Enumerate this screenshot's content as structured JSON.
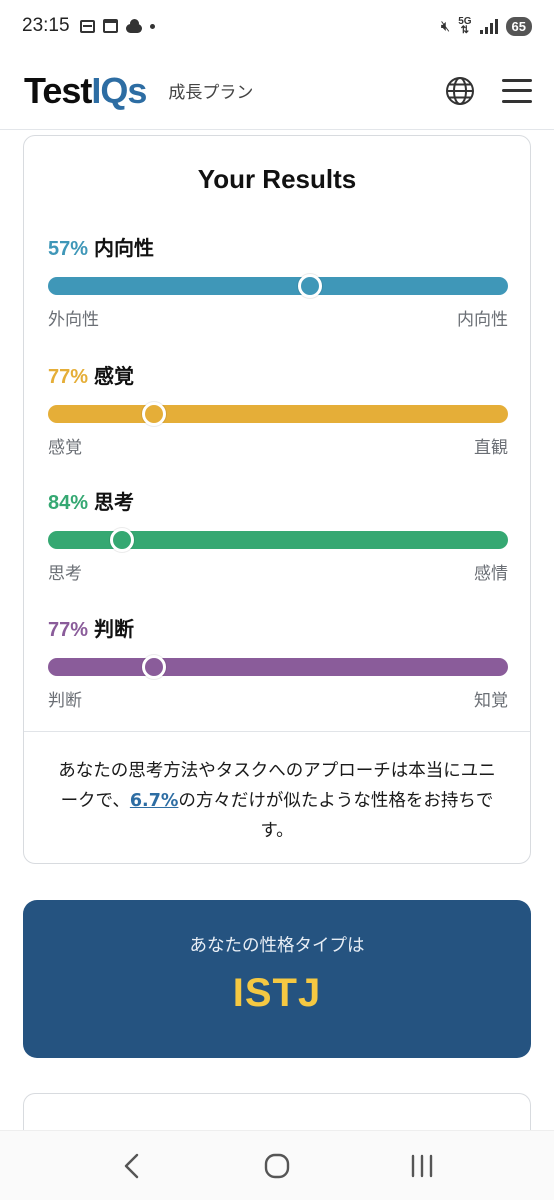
{
  "status_bar": {
    "time": "23:15",
    "network": "5G",
    "battery": "65"
  },
  "header": {
    "logo_part1": "Test",
    "logo_part2": "IQs",
    "plan_label": "成長プラン",
    "icons": [
      "globe-icon",
      "hamburger-menu-icon"
    ]
  },
  "results": {
    "title": "Your Results",
    "traits": [
      {
        "percent": "57%",
        "name": "内向性",
        "left": "外向性",
        "right": "内向性",
        "color": "#3f97b8",
        "level": 0.57
      },
      {
        "percent": "77%",
        "name": "感覚",
        "left": "感覚",
        "right": "直観",
        "color": "#e5ae38",
        "level": 0.23
      },
      {
        "percent": "84%",
        "name": "思考",
        "left": "思考",
        "right": "感情",
        "color": "#35a872",
        "level": 0.16
      },
      {
        "percent": "77%",
        "name": "判断",
        "left": "判断",
        "right": "知覚",
        "color": "#8a5c9a",
        "level": 0.23
      }
    ],
    "summary_before": "あなたの思考方法やタスクへのアプローチは本当にユニークで、",
    "summary_link": "6.7%",
    "summary_after": "の方々だけが似たような性格をお持ちです。"
  },
  "type_box": {
    "label": "あなたの性格タイプは",
    "value": "ISTJ",
    "bg_color": "#255380",
    "value_color": "#f5c842"
  },
  "nav_bar": {
    "icons": [
      "back-icon",
      "home-icon",
      "recent-apps-icon"
    ]
  }
}
